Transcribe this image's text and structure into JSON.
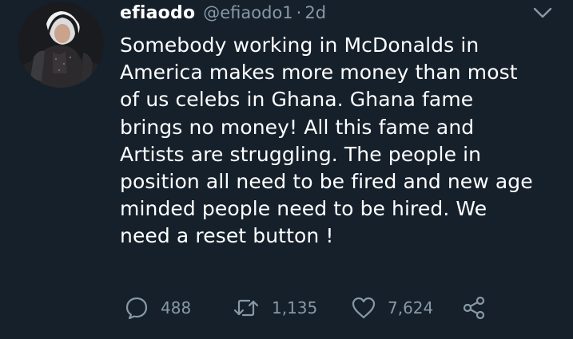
{
  "tweet": {
    "display_name": "efiaodo",
    "handle": "@efiaodo1",
    "separator": "·",
    "time": "2d",
    "body_lines": [
      "Somebody working in McDonalds in",
      "America makes more money than most",
      "of us celebs in Ghana. Ghana fame",
      "brings no money! All this fame and",
      "Artists are struggling. The people in",
      "position all need to be fired and new age",
      "minded people need to be hired. We",
      "need a reset button !"
    ],
    "actions": {
      "reply_count": "488",
      "retweet_count": "1,135",
      "like_count": "7,624"
    },
    "icons": {
      "avatar": "profile-photo",
      "caret": "chevron-down-icon",
      "reply": "reply-icon",
      "retweet": "retweet-icon",
      "like": "heart-icon",
      "share": "share-icon"
    }
  },
  "colors": {
    "background": "#15202b",
    "text_primary": "#ffffff",
    "text_secondary": "#8899a6"
  }
}
